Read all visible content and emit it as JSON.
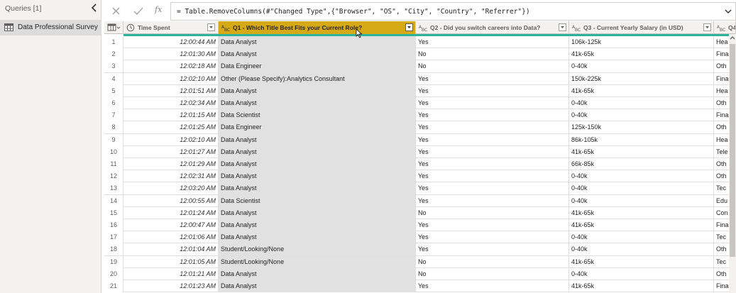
{
  "queries_pane": {
    "title": "Queries [1]",
    "query_name": "Data Professional Survey"
  },
  "formula_bar": {
    "formula": "= Table.RemoveColumns(#\"Changed Type\",{\"Browser\", \"OS\", \"City\", \"Country\", \"Referrer\"})",
    "fx_label": "fx"
  },
  "columns": {
    "time_spent": "Time Spent",
    "q1": "Q1 - Which Title Best Fits your Current Role?",
    "q2": "Q2 - Did you switch careers into Data?",
    "q3": "Q3 - Current Yearly Salary (in USD)",
    "q4": "Q4"
  },
  "rows": [
    {
      "n": "1",
      "time": "12:00:44 AM",
      "q1": "Data Analyst",
      "q2": "Yes",
      "q3": "106k-125k",
      "q4": "Hea"
    },
    {
      "n": "2",
      "time": "12:01:30 AM",
      "q1": "Data Analyst",
      "q2": "No",
      "q3": "41k-65k",
      "q4": "Fina"
    },
    {
      "n": "3",
      "time": "12:02:18 AM",
      "q1": "Data Engineer",
      "q2": "No",
      "q3": "0-40k",
      "q4": "Oth"
    },
    {
      "n": "4",
      "time": "12:02:10 AM",
      "q1": "Other (Please Specify):Analytics Consultant",
      "q2": "Yes",
      "q3": "150k-225k",
      "q4": "Fina"
    },
    {
      "n": "5",
      "time": "12:01:51 AM",
      "q1": "Data Analyst",
      "q2": "Yes",
      "q3": "41k-65k",
      "q4": "Hea"
    },
    {
      "n": "6",
      "time": "12:02:34 AM",
      "q1": "Data Analyst",
      "q2": "Yes",
      "q3": "0-40k",
      "q4": "Oth"
    },
    {
      "n": "7",
      "time": "12:01:15 AM",
      "q1": "Data Scientist",
      "q2": "Yes",
      "q3": "0-40k",
      "q4": "Fina"
    },
    {
      "n": "8",
      "time": "12:01:25 AM",
      "q1": "Data Engineer",
      "q2": "Yes",
      "q3": "125k-150k",
      "q4": "Oth"
    },
    {
      "n": "9",
      "time": "12:02:10 AM",
      "q1": "Data Analyst",
      "q2": "Yes",
      "q3": "86k-105k",
      "q4": "Hea"
    },
    {
      "n": "10",
      "time": "12:01:27 AM",
      "q1": "Data Analyst",
      "q2": "Yes",
      "q3": "41k-65k",
      "q4": "Tele"
    },
    {
      "n": "11",
      "time": "12:01:29 AM",
      "q1": "Data Analyst",
      "q2": "Yes",
      "q3": "66k-85k",
      "q4": "Oth"
    },
    {
      "n": "12",
      "time": "12:02:31 AM",
      "q1": "Data Analyst",
      "q2": "Yes",
      "q3": "0-40k",
      "q4": "Oth"
    },
    {
      "n": "13",
      "time": "12:03:20 AM",
      "q1": "Data Analyst",
      "q2": "Yes",
      "q3": "0-40k",
      "q4": "Tec"
    },
    {
      "n": "14",
      "time": "12:00:55 AM",
      "q1": "Data Scientist",
      "q2": "Yes",
      "q3": "0-40k",
      "q4": "Edu"
    },
    {
      "n": "15",
      "time": "12:01:24 AM",
      "q1": "Data Analyst",
      "q2": "No",
      "q3": "41k-65k",
      "q4": "Con"
    },
    {
      "n": "16",
      "time": "12:00:47 AM",
      "q1": "Data Analyst",
      "q2": "Yes",
      "q3": "41k-65k",
      "q4": "Fina"
    },
    {
      "n": "17",
      "time": "12:01:06 AM",
      "q1": "Data Analyst",
      "q2": "Yes",
      "q3": "0-40k",
      "q4": "Tec"
    },
    {
      "n": "18",
      "time": "12:01:04 AM",
      "q1": "Student/Looking/None",
      "q2": "Yes",
      "q3": "0-40k",
      "q4": "Oth"
    },
    {
      "n": "19",
      "time": "12:01:05 AM",
      "q1": "Student/Looking/None",
      "q2": "No",
      "q3": "41k-65k",
      "q4": "Tec"
    },
    {
      "n": "20",
      "time": "12:01:21 AM",
      "q1": "Data Analyst",
      "q2": "No",
      "q3": "0-40k",
      "q4": "Oth"
    },
    {
      "n": "21",
      "time": "12:01:23 AM",
      "q1": "Data Analyst",
      "q2": "Yes",
      "q3": "41k-65k",
      "q4": "Fina"
    }
  ],
  "icons": {
    "collapse": "chevron-left-icon",
    "query_table": "table-icon",
    "cancel": "close-icon",
    "commit": "check-icon",
    "expand_formula": "chevron-down-icon",
    "time_type": "clock-icon",
    "text_type": "abc-text-icon",
    "filter": "filter-dropdown-icon"
  },
  "colors": {
    "selected_column": "#d6a917",
    "quality_bar": "#2fb29b"
  }
}
